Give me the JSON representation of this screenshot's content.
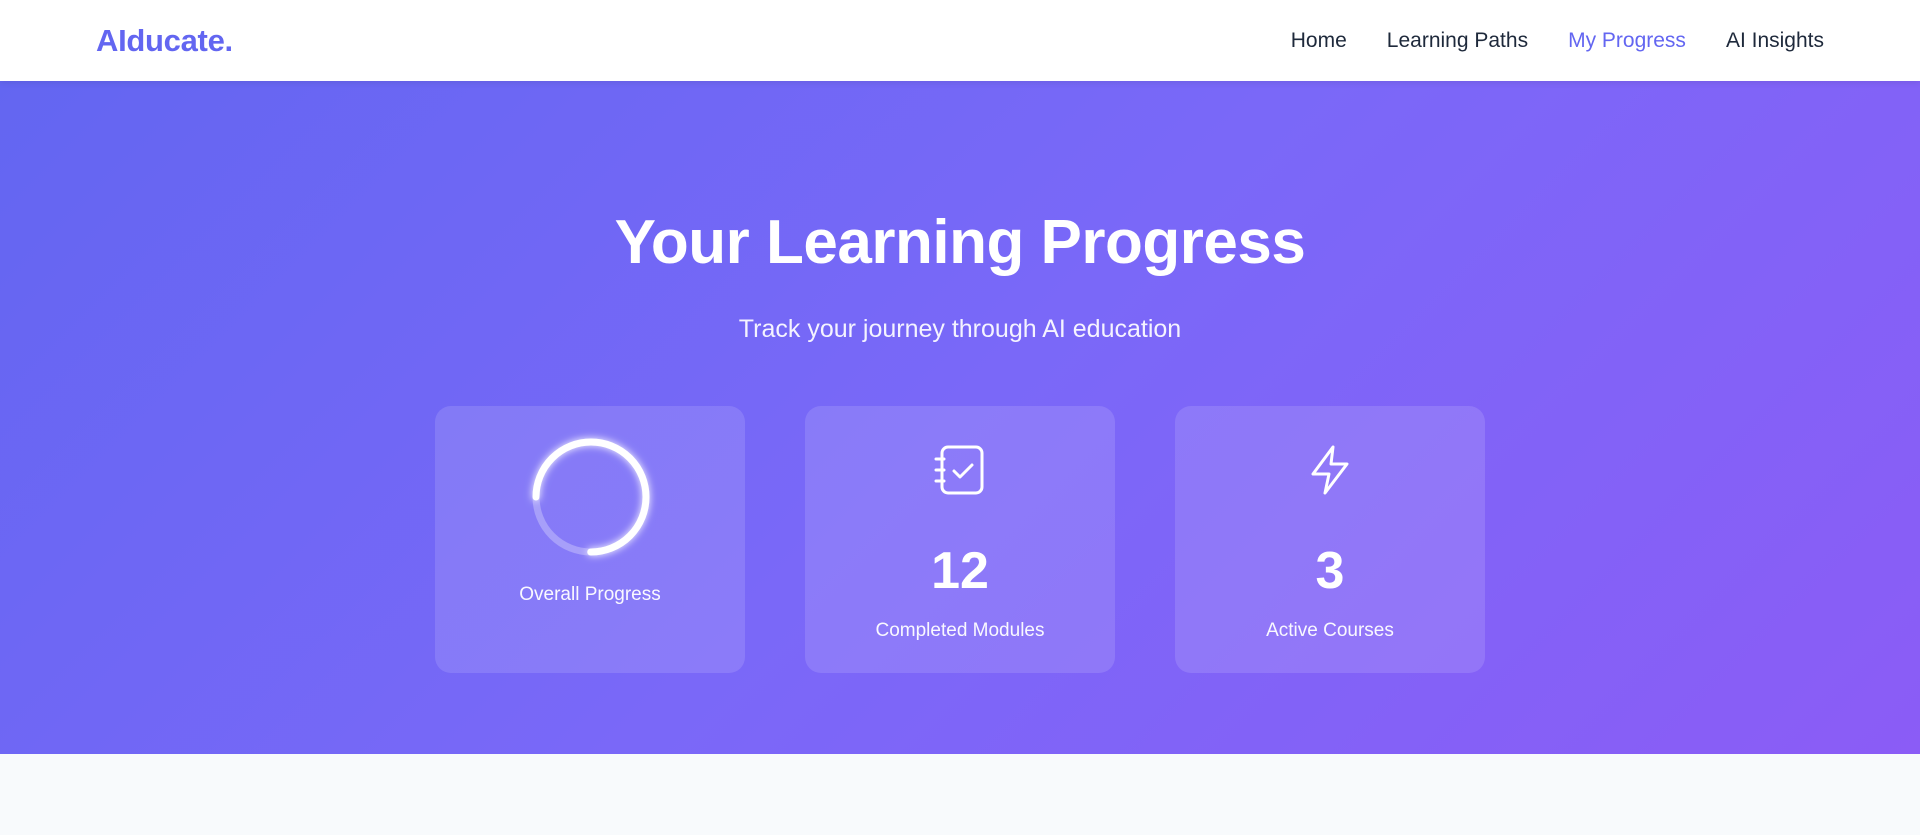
{
  "brand": {
    "name": "AIducate."
  },
  "nav": {
    "items": [
      {
        "label": "Home",
        "active": false
      },
      {
        "label": "Learning Paths",
        "active": false
      },
      {
        "label": "My Progress",
        "active": true
      },
      {
        "label": "AI Insights",
        "active": false
      }
    ]
  },
  "hero": {
    "title": "Your Learning Progress",
    "subtitle": "Track your journey through AI education"
  },
  "stats": {
    "overall": {
      "label": "Overall Progress",
      "progress_fraction": 0.75
    },
    "completed": {
      "value": "12",
      "label": "Completed Modules",
      "icon": "checklist-icon"
    },
    "active": {
      "value": "3",
      "label": "Active Courses",
      "icon": "lightning-icon"
    }
  },
  "colors": {
    "brand": "#6366f1",
    "gradient_start": "#6366f1",
    "gradient_end": "#8b5cf6",
    "page_background": "#f8fafc"
  }
}
